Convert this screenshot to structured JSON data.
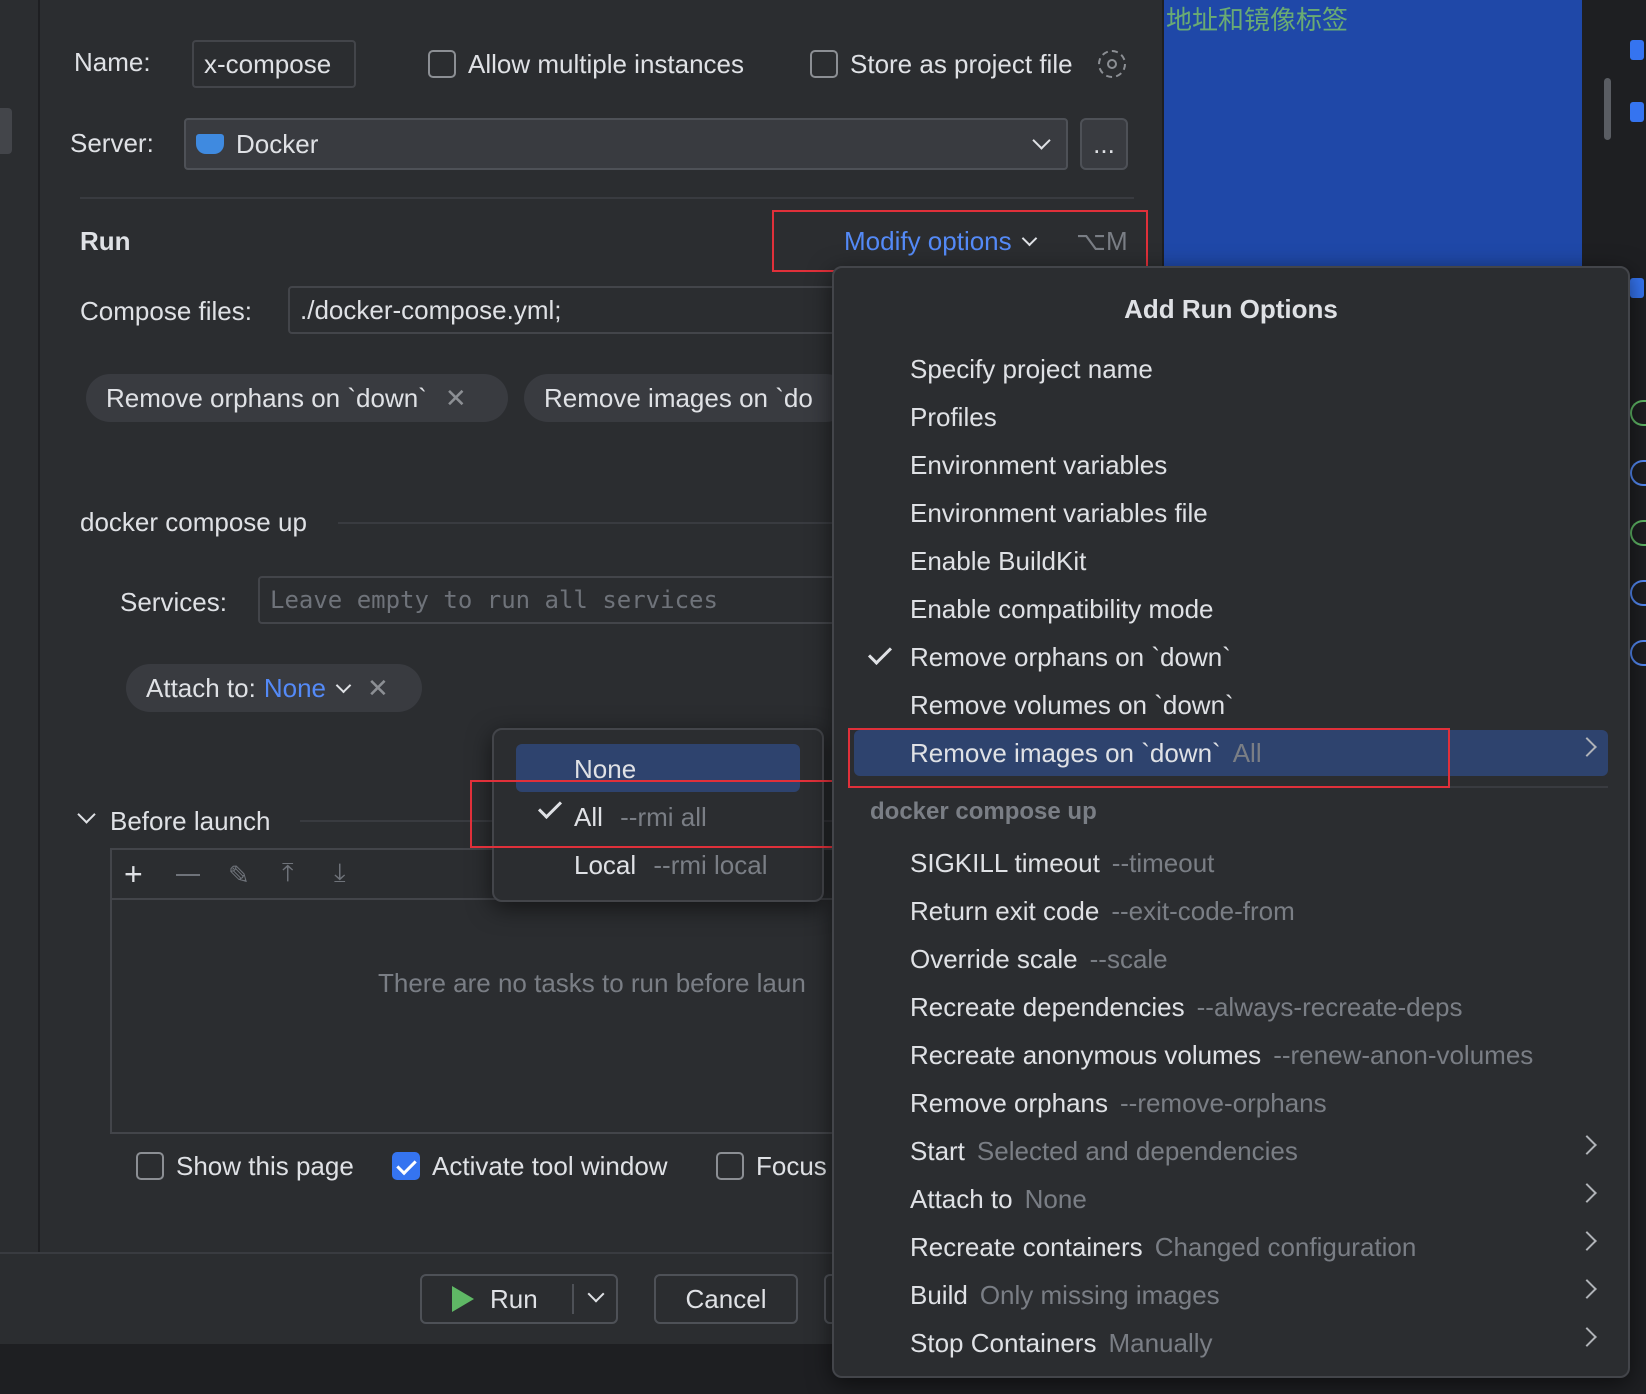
{
  "form": {
    "name_label": "Name:",
    "name_value": "x-compose",
    "allow_multiple_label": "Allow multiple instances",
    "store_project_label": "Store as project file",
    "server_label": "Server:",
    "server_value": "Docker",
    "more_label": "...",
    "run_section": "Run",
    "modify_options_label": "Modify options",
    "modify_shortcut": "⌥M",
    "compose_files_label": "Compose files:",
    "compose_files_value": "./docker-compose.yml;",
    "chip_orphans": "Remove orphans on `down`",
    "chip_images": "Remove images on `do",
    "compose_up_section": "docker compose up",
    "services_label": "Services:",
    "services_placeholder": "Leave empty to run all services",
    "attach_label": "Attach to:",
    "attach_value": "None",
    "before_launch": "Before launch",
    "no_tasks": "There are no tasks to run before laun",
    "show_page_label": "Show this page",
    "activate_tool_label": "Activate tool window",
    "focus_label": "Focus",
    "run_button": "Run",
    "cancel_button": "Cancel"
  },
  "editor": {
    "chinese_text": "地址和镜像标签"
  },
  "attach_menu": {
    "items": [
      {
        "label": "None",
        "hint": ""
      },
      {
        "label": "All",
        "hint": "--rmi all"
      },
      {
        "label": "Local",
        "hint": "--rmi local"
      }
    ]
  },
  "options_menu": {
    "title": "Add Run Options",
    "items": [
      {
        "label": "Specify project name",
        "hint": ""
      },
      {
        "label": "Profiles",
        "hint": ""
      },
      {
        "label": "Environment variables",
        "hint": ""
      },
      {
        "label": "Environment variables file",
        "hint": ""
      },
      {
        "label": "Enable BuildKit",
        "hint": ""
      },
      {
        "label": "Enable compatibility mode",
        "hint": ""
      },
      {
        "label": "Remove orphans on `down`",
        "hint": ""
      },
      {
        "label": "Remove volumes on `down`",
        "hint": ""
      },
      {
        "label": "Remove images on `down`",
        "hint": "All"
      }
    ],
    "group_label": "docker compose up",
    "group_items": [
      {
        "label": "SIGKILL timeout",
        "hint": "--timeout"
      },
      {
        "label": "Return exit code",
        "hint": "--exit-code-from"
      },
      {
        "label": "Override scale",
        "hint": "--scale"
      },
      {
        "label": "Recreate dependencies",
        "hint": "--always-recreate-deps"
      },
      {
        "label": "Recreate anonymous volumes",
        "hint": "--renew-anon-volumes"
      },
      {
        "label": "Remove orphans",
        "hint": "--remove-orphans"
      },
      {
        "label": "Start",
        "hint": "Selected and dependencies"
      },
      {
        "label": "Attach to",
        "hint": "None"
      },
      {
        "label": "Recreate containers",
        "hint": "Changed configuration"
      },
      {
        "label": "Build",
        "hint": "Only missing images"
      },
      {
        "label": "Stop Containers",
        "hint": "Manually"
      }
    ]
  },
  "colors": {
    "accent": "#548af7",
    "selection": "#2e436e",
    "highlight_border": "#e0303a",
    "editor_blue": "#1f48a8"
  }
}
